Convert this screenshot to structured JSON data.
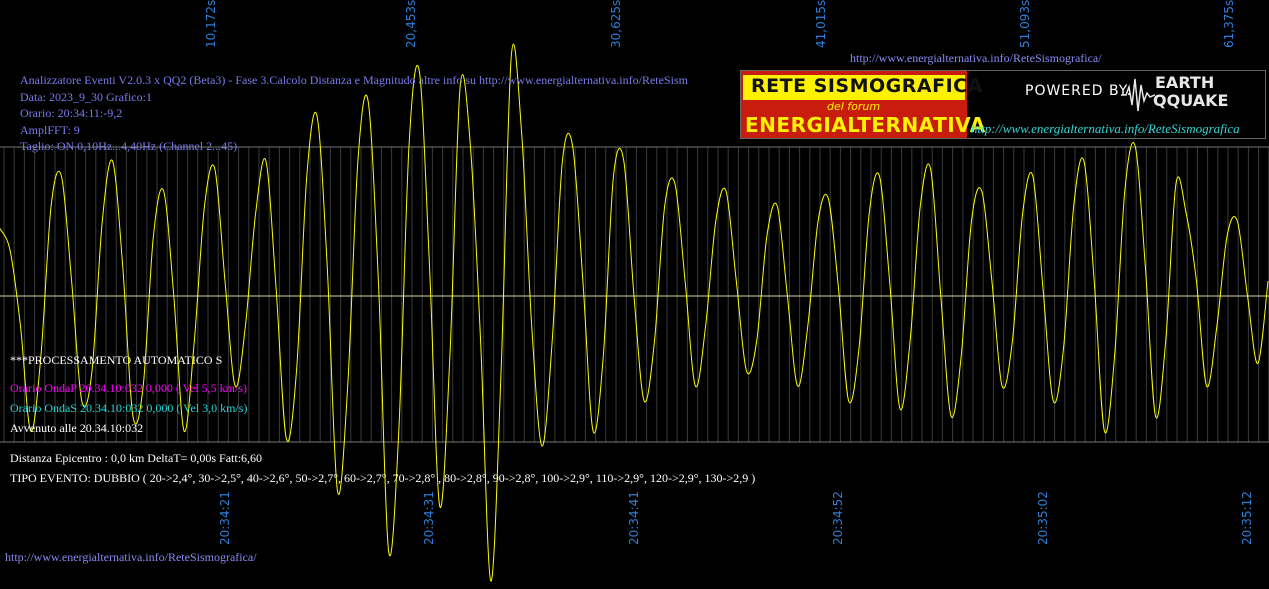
{
  "top_url": "http://www.energialternativa.info/ReteSismografica/",
  "bottom_url": "http://www.energialternativa.info/ReteSismografica/",
  "header": {
    "line1": "Analizzatore Eventi V2.0.3 x QQ2 (Beta3) - Fase 3.Calcolo Distanza e Magnitudo altre info su http://www.energialternativa.info/ReteSism",
    "line2": "Data: 2023_9_30 Grafico:1",
    "line3": "Orario: 20:34:11:-9,2",
    "line4": "AmplFFT: 9",
    "line5": "Taglio: ON 0,10Hz...4,40Hz       (Channel 2...45)"
  },
  "logo": {
    "title1": "RETE SISMOGRAFICA",
    "title2": "del forum",
    "title3": "ENERGIALTERNATIVA",
    "powered": "POWERED BY:",
    "brand1": "EARTH",
    "brand2": "QQUAKE",
    "url": "http://www.energialternativa.info/ReteSismografica"
  },
  "info": {
    "processing": "***PROCESSAMENTO AUTOMATICO S",
    "p_wave": "Orario OndaP 20.34.10:032  0,000 ( Vel 5,5 km/s)",
    "s_wave": "Orario OndaS 20.34.10:032  0,000 ( Vel 3,0 km/s)",
    "occurred": "Avvenuto alle 20.34.10:032",
    "distance": "Distanza Epicentro : 0,0 km DeltaT= 0,00s  Fatt:6,60",
    "event_type": "TIPO EVENTO: DUBBIO ( 20->2,4°, 30->2,5°, 40->2,6°, 50->2,7°, 60->2,7°, 70->2,8° , 80->2,8°, 90->2,8°, 100->2,9°, 110->2,9°, 120->2,9°, 130->2,9 )"
  },
  "colors": {
    "trace": "#ffff00",
    "axis_labels": "#2e7fd8",
    "header_text": "#7b7bef",
    "grid": "#555555",
    "p_wave": "#ff00ff",
    "s_wave": "#22d7d7"
  },
  "chart_data": {
    "type": "line",
    "title": "",
    "xlabel": "",
    "ylabel": "",
    "top_axis_ticks": [
      "10,172s",
      "20,453s",
      "30,625s",
      "41,015s",
      "51,093s",
      "61,375s"
    ],
    "bottom_axis_ticks": [
      "20:34:21",
      "20:34:31",
      "20:34:41",
      "20:34:52",
      "20:35:02",
      "20:35:12"
    ],
    "grid": true,
    "series": [
      {
        "values": [
          0.45,
          0.3,
          -0.2,
          -0.9,
          -0.4,
          0.6,
          0.8,
          0.1,
          -0.7,
          -0.5,
          0.5,
          0.9,
          0.2,
          -0.8,
          -0.6,
          0.4,
          0.7,
          0.0,
          -0.9,
          -0.3,
          0.6,
          0.85,
          0.1,
          -0.6,
          -0.2,
          0.55,
          0.9,
          0.05,
          -0.95,
          -0.5,
          0.8,
          1.2,
          0.2,
          -1.3,
          -0.6,
          0.9,
          1.3,
          0.1,
          -1.7,
          -0.9,
          1.0,
          1.5,
          0.2,
          -1.4,
          -0.4,
          1.4,
          1.0,
          -0.3,
          -1.9,
          -0.5,
          1.6,
          1.1,
          -0.2,
          -1.0,
          -0.3,
          0.9,
          1.0,
          0.1,
          -0.9,
          -0.4,
          0.8,
          0.9,
          0.0,
          -0.7,
          -0.3,
          0.6,
          0.75,
          0.1,
          -0.6,
          -0.2,
          0.5,
          0.7,
          0.1,
          -0.5,
          -0.3,
          0.4,
          0.6,
          0.0,
          -0.6,
          -0.2,
          0.5,
          0.65,
          0.05,
          -0.7,
          -0.35,
          0.55,
          0.8,
          0.1,
          -0.75,
          -0.3,
          0.6,
          0.85,
          0.0,
          -0.8,
          -0.4,
          0.5,
          0.7,
          0.1,
          -0.6,
          -0.3,
          0.55,
          0.8,
          0.05,
          -0.7,
          -0.35,
          0.6,
          0.9,
          0.1,
          -0.9,
          -0.4,
          0.7,
          1.0,
          0.2,
          -0.8,
          -0.3,
          0.75,
          0.55,
          0.1,
          -0.6,
          -0.2,
          0.4,
          0.5,
          0.0,
          -0.45,
          0.1
        ],
        "yunits": "relative amplitude"
      }
    ]
  }
}
